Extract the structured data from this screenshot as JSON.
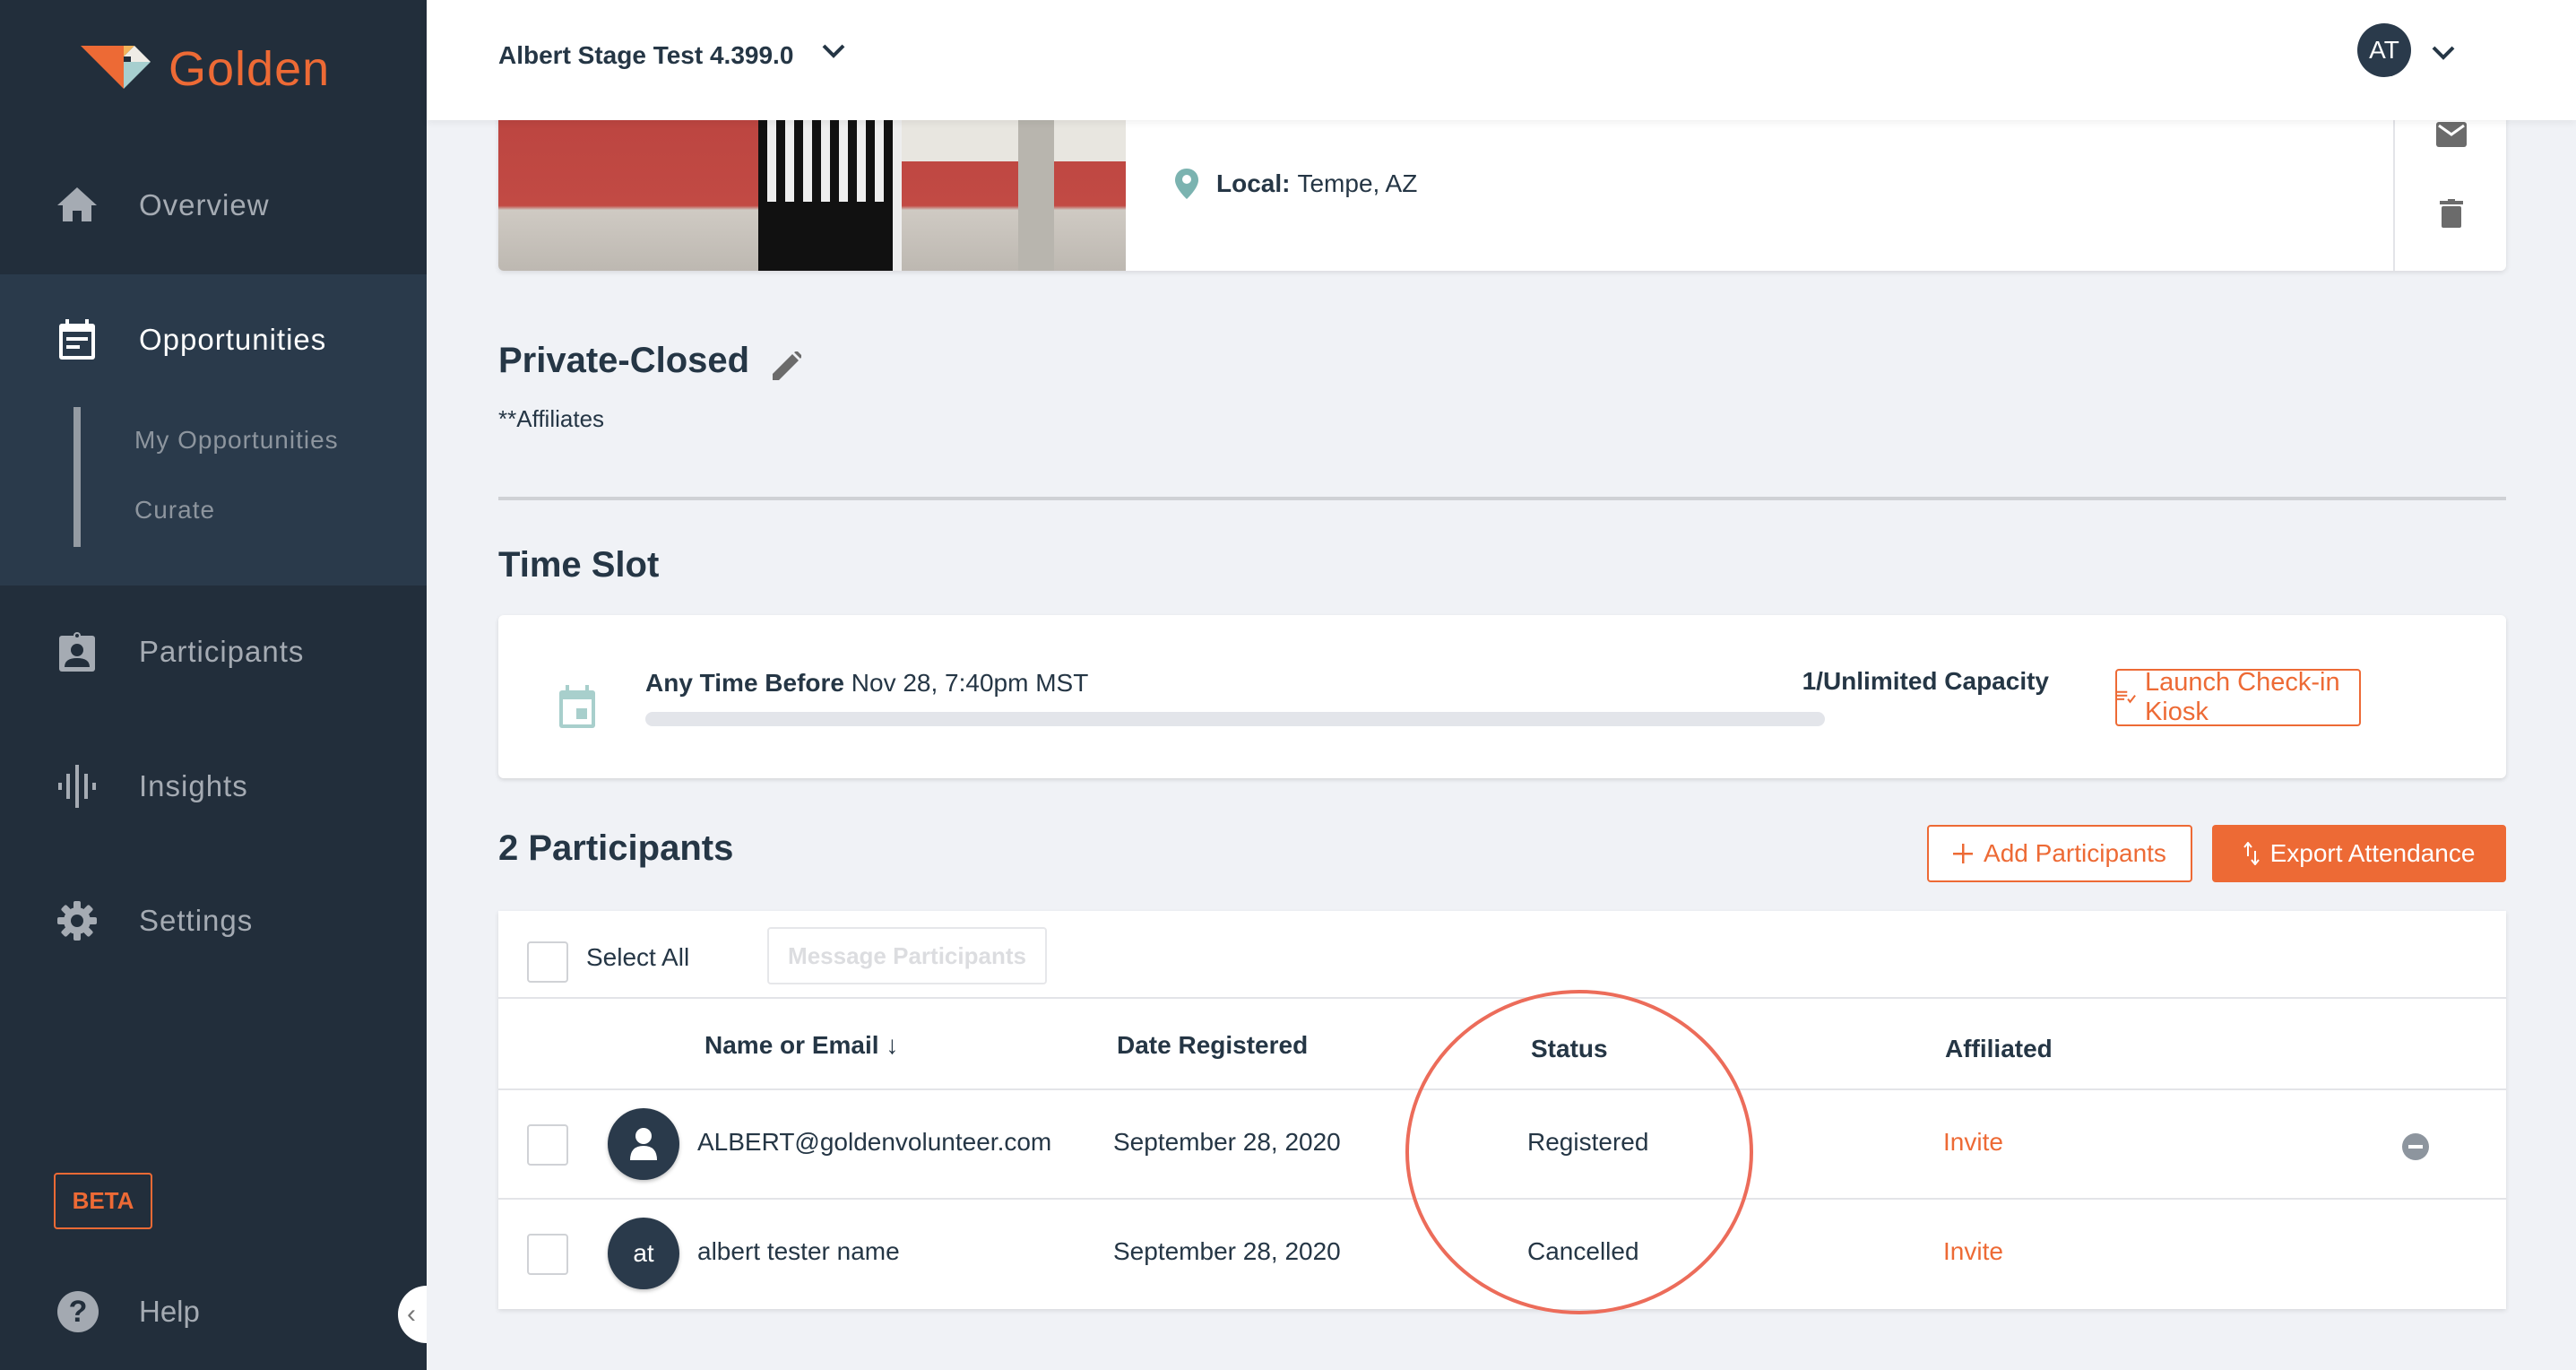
{
  "brand": {
    "name": "Golden",
    "accent": "#ed6a35"
  },
  "sidebar": {
    "items": [
      {
        "label": "Overview",
        "icon": "home-icon"
      },
      {
        "label": "Opportunities",
        "icon": "calendar-note-icon",
        "active": true,
        "children": [
          {
            "label": "My Opportunities"
          },
          {
            "label": "Curate"
          }
        ]
      },
      {
        "label": "Participants",
        "icon": "badge-person-icon"
      },
      {
        "label": "Insights",
        "icon": "waveform-icon"
      },
      {
        "label": "Settings",
        "icon": "gear-icon"
      }
    ],
    "beta_label": "BETA",
    "help_label": "Help",
    "help_icon_glyph": "?",
    "collapse_glyph": "‹"
  },
  "header": {
    "org_name": "Albert Stage Test 4.399.0",
    "user_initials": "AT"
  },
  "event": {
    "location_label": "Local:",
    "location_value": "Tempe, AZ"
  },
  "opportunity": {
    "title": "Private-Closed",
    "subtitle": "**Affiliates"
  },
  "time_slot": {
    "heading": "Time Slot",
    "label_bold": "Any Time Before",
    "datetime": "Nov 28, 7:40pm MST",
    "capacity": "1/Unlimited Capacity",
    "fill_fraction": 0,
    "kiosk_button": "Launch Check-in Kiosk"
  },
  "participants": {
    "heading": "2 Participants",
    "add_button": "Add Participants",
    "export_button": "Export Attendance",
    "select_all": "Select All",
    "message_button": "Message Participants",
    "columns": [
      "Name or Email",
      "Date Registered",
      "Status",
      "Affiliated"
    ],
    "sort_glyph": "↓",
    "rows": [
      {
        "avatar": "",
        "name": "ALBERT@goldenvolunteer.com",
        "date": "September 28, 2020",
        "status": "Registered",
        "affiliated": "Invite"
      },
      {
        "avatar": "at",
        "name": "albert tester name",
        "date": "September 28, 2020",
        "status": "Cancelled",
        "affiliated": "Invite"
      }
    ]
  }
}
